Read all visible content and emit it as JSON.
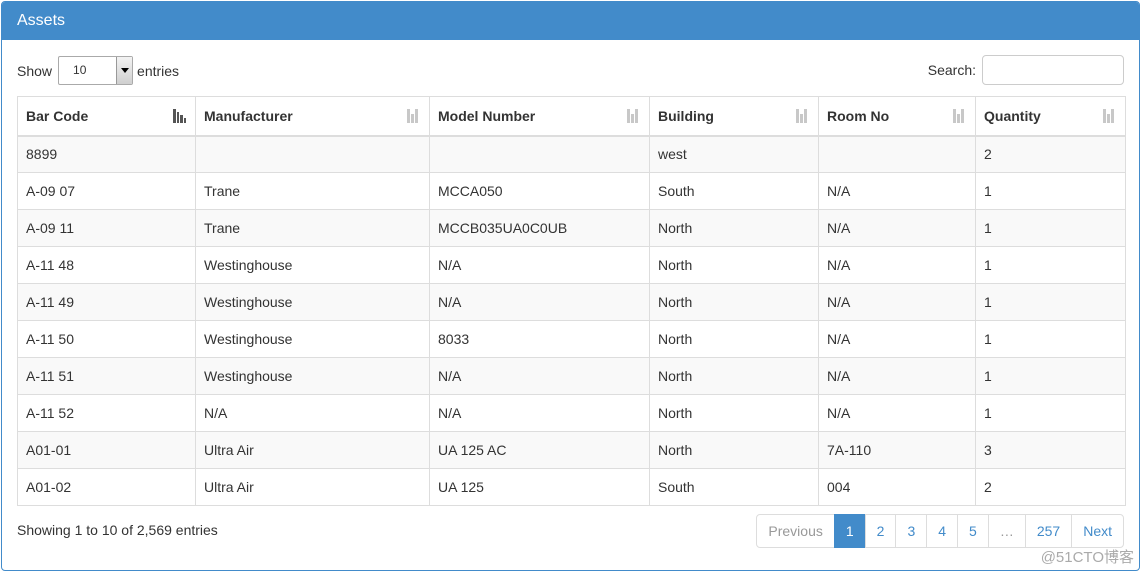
{
  "panel": {
    "title": "Assets"
  },
  "length": {
    "show_label": "Show",
    "selected": "10",
    "entries_label": "entries"
  },
  "search": {
    "label": "Search:",
    "value": "",
    "placeholder": ""
  },
  "table": {
    "columns": [
      "Bar Code",
      "Manufacturer",
      "Model Number",
      "Building",
      "Room No",
      "Quantity"
    ],
    "sorted_column": "Bar Code",
    "rows": [
      [
        "8899",
        "",
        "",
        "west",
        "",
        "2"
      ],
      [
        "A-09 07",
        "Trane",
        "MCCA050",
        "South",
        "N/A",
        "1"
      ],
      [
        "A-09 11",
        "Trane",
        "MCCB035UA0C0UB",
        "North",
        "N/A",
        "1"
      ],
      [
        "A-11 48",
        "Westinghouse",
        "N/A",
        "North",
        "N/A",
        "1"
      ],
      [
        "A-11 49",
        "Westinghouse",
        "N/A",
        "North",
        "N/A",
        "1"
      ],
      [
        "A-11 50",
        "Westinghouse",
        "8033",
        "North",
        "N/A",
        "1"
      ],
      [
        "A-11 51",
        "Westinghouse",
        "N/A",
        "North",
        "N/A",
        "1"
      ],
      [
        "A-11 52",
        "N/A",
        "N/A",
        "North",
        "N/A",
        "1"
      ],
      [
        "A01-01",
        "Ultra Air",
        "UA 125 AC",
        "North",
        "7A-110",
        "3"
      ],
      [
        "A01-02",
        "Ultra Air",
        "UA 125",
        "South",
        "004",
        "2"
      ]
    ]
  },
  "info": "Showing 1 to 10 of 2,569 entries",
  "pagination": {
    "previous": "Previous",
    "pages": [
      "1",
      "2",
      "3",
      "4",
      "5",
      "…",
      "257"
    ],
    "current": "1",
    "next": "Next"
  },
  "watermark": "@51CTO博客",
  "colors": {
    "accent": "#428bca",
    "stripe": "#f9f9f9",
    "border": "#dddddd"
  },
  "icons": {
    "sort": "sort-icon",
    "sort_active": "sort-asc-icon",
    "dropdown": "chevron-down-icon"
  }
}
